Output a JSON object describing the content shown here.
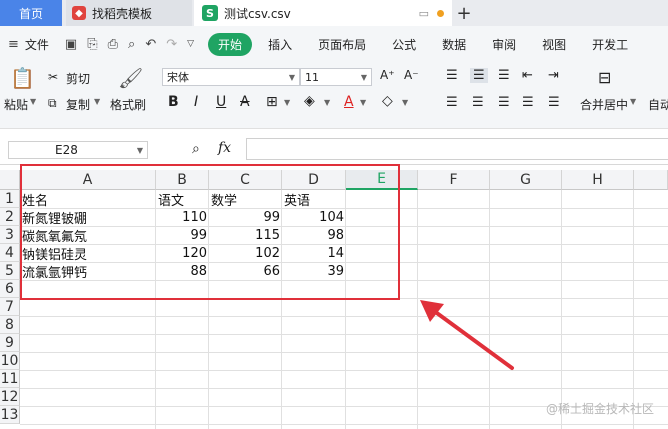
{
  "tabs": [
    {
      "label": "首页"
    },
    {
      "label": "找稻壳模板"
    },
    {
      "label": "测试csv.csv"
    }
  ],
  "menu": {
    "file": "文件",
    "items": [
      "开始",
      "插入",
      "页面布局",
      "公式",
      "数据",
      "审阅",
      "视图",
      "开发工"
    ]
  },
  "ribbon": {
    "paste": "粘贴",
    "cut": "剪切",
    "copy": "复制",
    "format_painter": "格式刷",
    "font_name": "宋体",
    "font_size": "11",
    "merge_center": "合并居中",
    "auto": "自动"
  },
  "formula_bar": {
    "cell_ref": "E28",
    "fx": "fx",
    "content": ""
  },
  "sheet": {
    "columns": [
      "A",
      "B",
      "C",
      "D",
      "E",
      "F",
      "G",
      "H"
    ],
    "selected_column": "E",
    "rows": [
      "1",
      "2",
      "3",
      "4",
      "5",
      "6",
      "7",
      "8",
      "9",
      "10",
      "11",
      "12",
      "13"
    ],
    "header_row": [
      "姓名",
      "语文",
      "数学",
      "英语"
    ],
    "data_rows": [
      [
        "新氮锂铍硼",
        "110",
        "99",
        "104"
      ],
      [
        "碳氮氧氟氖",
        "99",
        "115",
        "98"
      ],
      [
        "钠镁铝硅灵",
        "120",
        "102",
        "14"
      ],
      [
        "流氯氩钾钙",
        "88",
        "66",
        "39"
      ]
    ]
  },
  "watermark": "@稀土掘金技术社区",
  "colors": {
    "accent": "#1fa463",
    "highlight_box": "#e0303a",
    "home_tab": "#4a84e8"
  }
}
